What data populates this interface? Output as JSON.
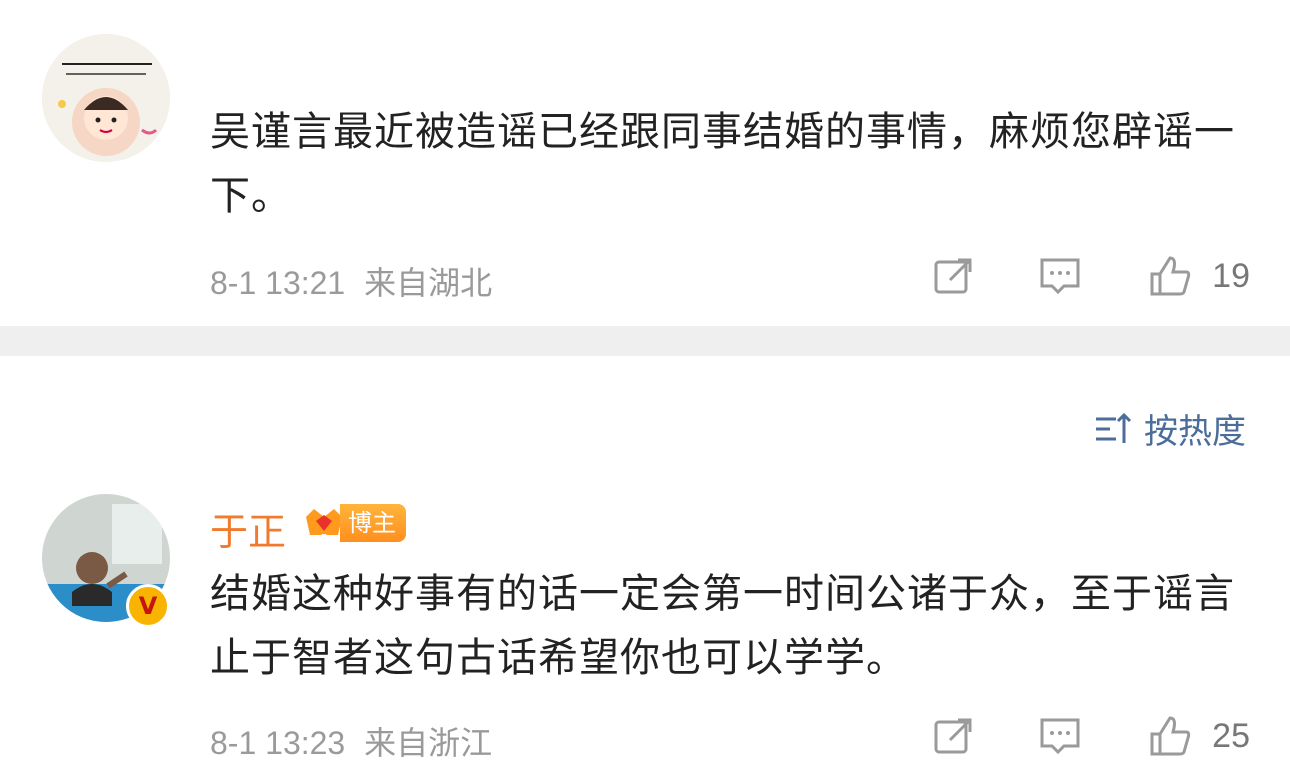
{
  "post": {
    "text": "吴谨言最近被造谣已经跟同事结婚的事情，麻烦您辟谣一下。",
    "timestamp": "8-1 13:21",
    "location": "来自湖北",
    "like_count": "19",
    "avatar_icon": "sticker-avatar",
    "share_icon": "share-icon",
    "comment_icon": "comment-icon",
    "like_icon": "thumbs-up-icon"
  },
  "sort": {
    "label": "按热度",
    "icon": "sort-icon"
  },
  "comment": {
    "username": "于正",
    "badge_label": "博主",
    "badge_icon": "crown-icon",
    "verified_icon": "verified-v-icon",
    "text": "结婚这种好事有的话一定会第一时间公诸于众，至于谣言止于智者这句古话希望你也可以学学。",
    "timestamp": "8-1 13:23",
    "location": "来自浙江",
    "like_count": "25"
  },
  "colors": {
    "username": "#f07a2d",
    "sort_link": "#4b6d9a",
    "divider": "#efefef",
    "meta": "#9a9a9a"
  }
}
